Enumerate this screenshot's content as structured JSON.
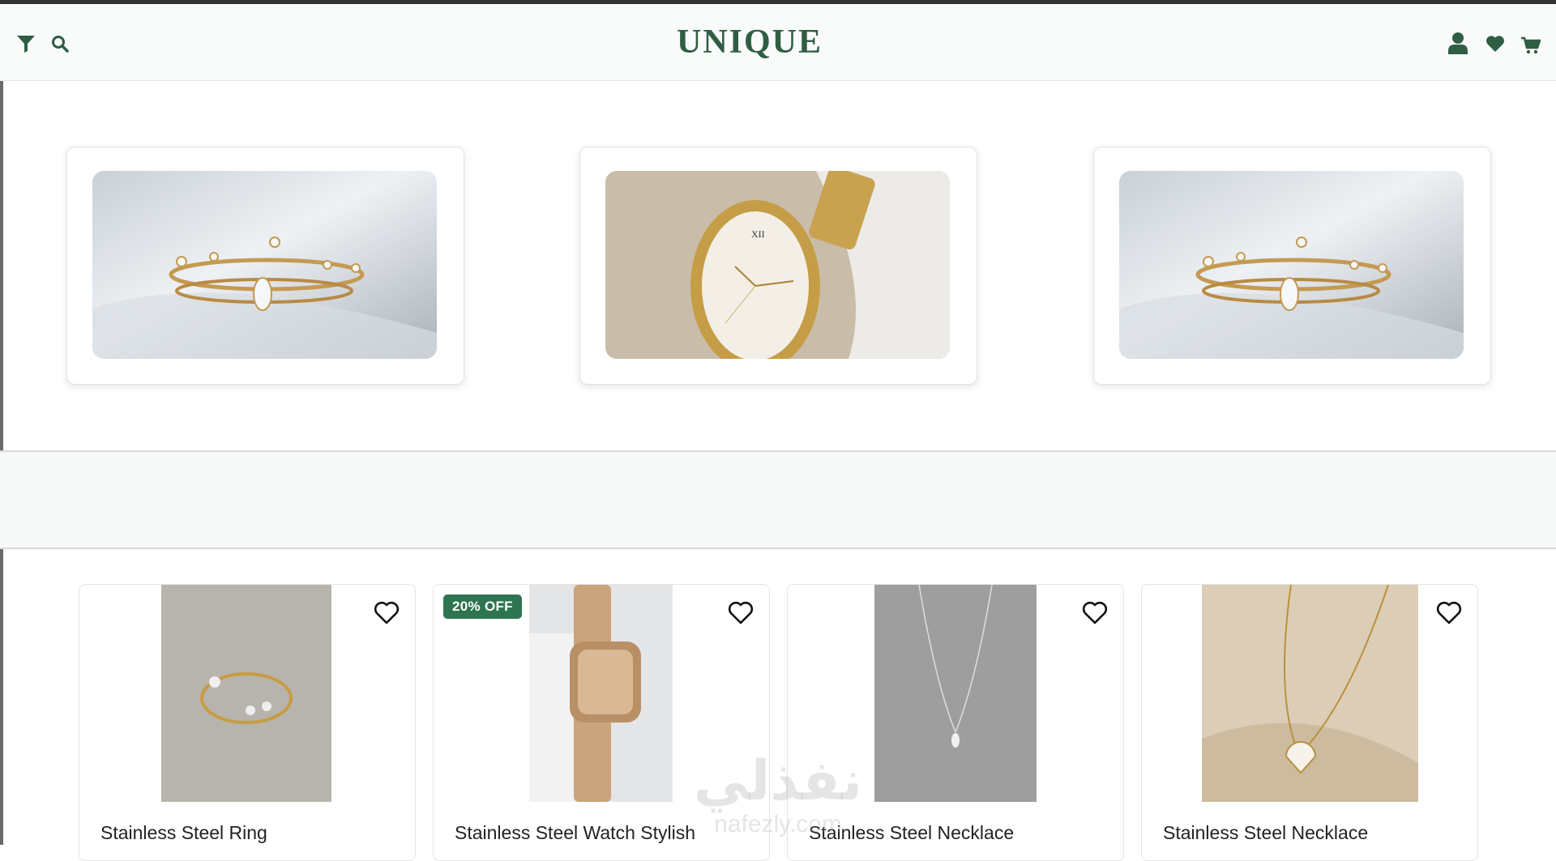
{
  "header": {
    "brand": "UNIQUE",
    "left_icons": [
      "filter-icon",
      "search-icon"
    ],
    "right_icons": [
      "user-icon",
      "heart-icon",
      "cart-icon"
    ],
    "brand_color": "#2f5e43"
  },
  "carousel": {
    "slides": [
      {
        "image": "gold rings on satin"
      },
      {
        "image": "gold oval watch"
      },
      {
        "image": "gold rings on satin"
      }
    ]
  },
  "products": [
    {
      "name": "Stainless Steel Ring",
      "badge": ""
    },
    {
      "name": "Stainless Steel Watch Stylish",
      "badge": "20% OFF"
    },
    {
      "name": "Stainless Steel Necklace",
      "badge": ""
    },
    {
      "name": "Stainless Steel Necklace",
      "badge": ""
    }
  ],
  "watermark": {
    "arabic": "نفذلي",
    "latin": "nafezly.com"
  },
  "colors": {
    "accent": "#2f5e43",
    "badge": "#2f7450"
  }
}
